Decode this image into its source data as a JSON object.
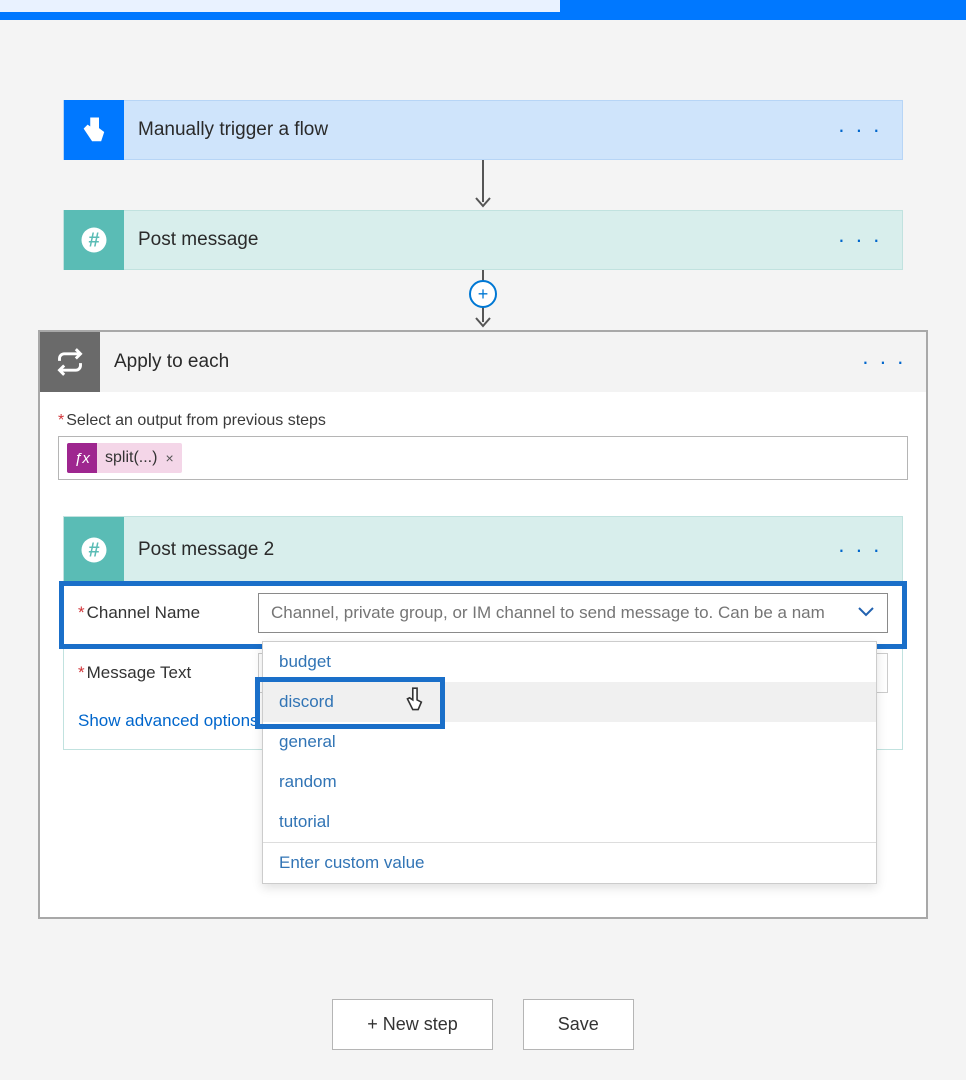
{
  "trigger": {
    "title": "Manually trigger a flow"
  },
  "action1": {
    "title": "Post message"
  },
  "foreach": {
    "title": "Apply to each",
    "select_label": "Select an output from previous steps",
    "token_name": "split(...)"
  },
  "nested": {
    "title": "Post message 2",
    "channel_label": "Channel Name",
    "channel_placeholder": "Channel, private group, or IM channel to send message to. Can be a nam",
    "message_label": "Message Text",
    "advanced_link": "Show advanced options",
    "dropdown_items": [
      "budget",
      "discord",
      "general",
      "random",
      "tutorial"
    ],
    "custom_value": "Enter custom value"
  },
  "add_action": "Add an action",
  "footer": {
    "new_step": "+ New step",
    "save": "Save"
  }
}
